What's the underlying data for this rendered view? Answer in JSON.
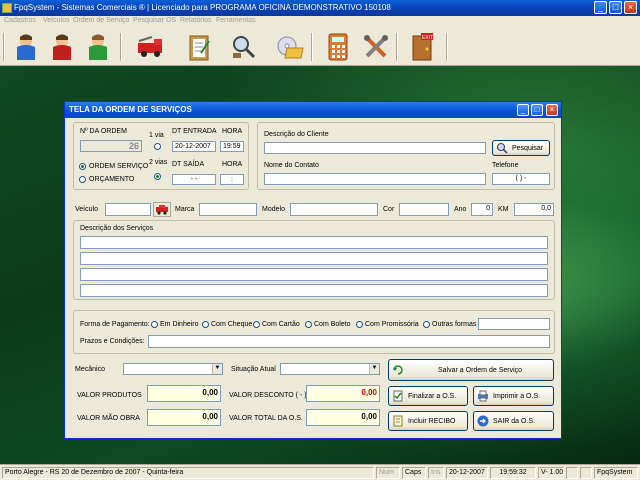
{
  "window": {
    "title": "FpqSystem - Sistemas Comerciais ®  |  Licenciado para  PROGRAMA OFICINA DEMONSTRATIVO 150108",
    "minimize": "_",
    "maximize": "□",
    "close": "×"
  },
  "menu": [
    "Cadastros",
    "Veículos",
    "Ordem de Serviço",
    "Pesquisar OS",
    "Relatórios",
    "Ferramentas"
  ],
  "toolbar": {
    "icons": [
      "user-blue-icon",
      "user-red-icon",
      "user-green-icon",
      "fire-truck-icon",
      "clipboard-icon",
      "magnifier-tools-icon",
      "cd-folder-icon",
      "calculator-icon",
      "tools-icon",
      "exit-door-icon"
    ]
  },
  "dialog": {
    "title": "TELA DA ORDEM DE SERVIÇOS",
    "order": {
      "num_label": "Nº DA ORDEM",
      "num_value": "26",
      "via1_label": "1 via",
      "via2_label": "2 vias",
      "dt_entrada_label": "DT ENTRADA",
      "dt_entrada_value": "20-12-2007",
      "hora_label": "HORA",
      "hora_value": "19:59",
      "dt_saida_label": "DT SAÍDA",
      "dt_saida_value": "  -  -",
      "hora2_label": "HORA",
      "hora2_value": "  :",
      "radio_os": "ORDEM SERVIÇO",
      "radio_orc": "ORÇAMENTO",
      "via_selected": "2 vias",
      "type_selected": "ORDEM SERVIÇO"
    },
    "client": {
      "desc_label": "Descrição do Cliente",
      "desc_value": "",
      "search_button": "Pesquisar",
      "contact_label": "Nome do Contato",
      "contact_value": "",
      "phone_label": "Telefone",
      "phone_value": "(  )   -"
    },
    "vehicle": {
      "veiculo_label": "Veículo",
      "veiculo_value": "",
      "marca_label": "Marca",
      "marca_value": "",
      "modelo_label": "Modelo",
      "modelo_value": "",
      "cor_label": "Cor",
      "cor_value": "",
      "ano_label": "Ano",
      "ano_value": "0",
      "km_label": "KM",
      "km_value": "0,0"
    },
    "services": {
      "label": "Descrição dos Serviços",
      "lines": [
        "",
        "",
        "",
        ""
      ]
    },
    "payment": {
      "label": "Forma de Pagamento:",
      "options": [
        "Em Dinheiro",
        "Com Cheque",
        "Com Cartão",
        "Com Boleto",
        "Com Promissória",
        "Outras formas"
      ],
      "other_value": "",
      "terms_label": "Prazos e  Condições:",
      "terms_value": ""
    },
    "staff": {
      "mecanico_label": "Mecânico",
      "mecanico_value": "",
      "situacao_label": "Situação Atual",
      "situacao_value": ""
    },
    "totals": {
      "produtos_label": "VALOR PRODUTOS",
      "produtos_value": "0,00",
      "desconto_label": "VALOR DESCONTO ( - )",
      "desconto_value": "0,00",
      "mao_obra_label": "VALOR MÃO OBRA",
      "mao_obra_value": "0,00",
      "total_label": "VALOR TOTAL DA O.S.",
      "total_value": "0,00"
    },
    "buttons": {
      "save": "Salvar a Ordem de Serviço",
      "finalize": "Finalizar a O.S.",
      "print": "Imprimir a O.S.",
      "receipt": "Incluir RECIBO",
      "exit": "SAIR da O.S."
    }
  },
  "status": {
    "location": "Porto Alegre - RS 20 de Dezembro de 2007 - Quinta-feira",
    "num": "Num",
    "caps": "Caps",
    "ins": "Ins",
    "date": "20-12-2007",
    "time": "19:59:32",
    "version": "V-  1.00",
    "app": "FpqSystem"
  }
}
